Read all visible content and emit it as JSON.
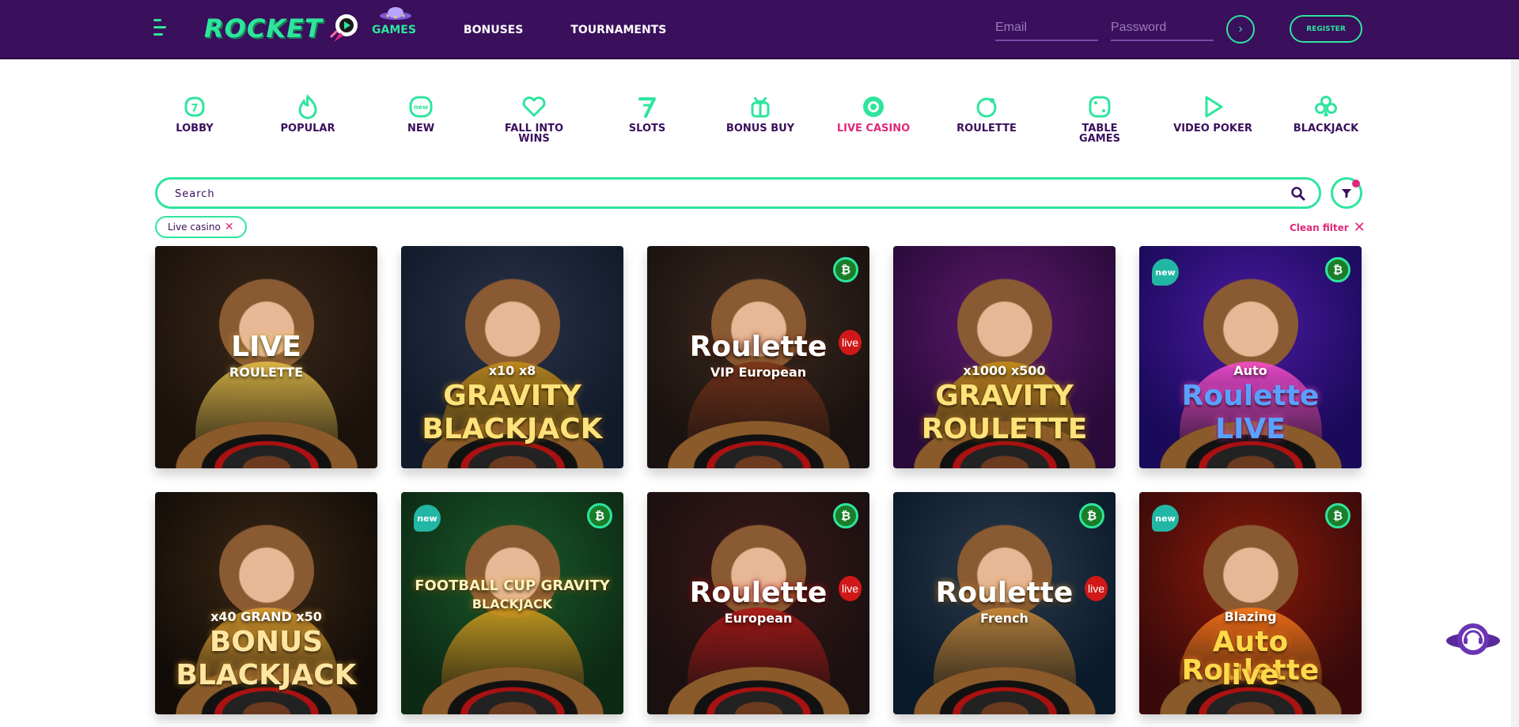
{
  "header": {
    "logo_text": "ROCKET",
    "nav": [
      {
        "label": "GAMES",
        "active": true
      },
      {
        "label": "BONUSES",
        "active": false
      },
      {
        "label": "TOURNAMENTS",
        "active": false
      }
    ],
    "email_placeholder": "Email",
    "password_placeholder": "Password",
    "login_icon": "chevron-right-icon",
    "register_label": "REGISTER"
  },
  "categories": [
    {
      "label": "LOBBY",
      "icon": "lobby-icon",
      "active": false
    },
    {
      "label": "POPULAR",
      "icon": "flame-icon",
      "active": false
    },
    {
      "label": "NEW",
      "icon": "new-icon",
      "active": false
    },
    {
      "label": "FALL INTO WINS",
      "icon": "heart-icon",
      "active": false
    },
    {
      "label": "SLOTS",
      "icon": "seven-icon",
      "active": false
    },
    {
      "label": "BONUS BUY",
      "icon": "gift-icon",
      "active": false
    },
    {
      "label": "LIVE CASINO",
      "icon": "chip-icon",
      "active": true
    },
    {
      "label": "ROULETTE",
      "icon": "roulette-icon",
      "active": false
    },
    {
      "label": "TABLE GAMES",
      "icon": "dice-icon",
      "active": false
    },
    {
      "label": "VIDEO POKER",
      "icon": "play-icon",
      "active": false
    },
    {
      "label": "BLACKJACK",
      "icon": "club-icon",
      "active": false
    }
  ],
  "search": {
    "placeholder": "Search"
  },
  "filter": {
    "chip_label": "Live casino",
    "clean_label": "Clean filter"
  },
  "games": [
    {
      "title_lines": [
        "LIVE",
        "ROULETTE"
      ],
      "new": false,
      "btc": false,
      "colors": [
        "#1b120c",
        "#3a2718"
      ],
      "title_color": "#ffffff",
      "accent": "#e8c14a"
    },
    {
      "title_lines": [
        "x10  x8",
        "GRAVITY",
        "BLACKJACK"
      ],
      "new": false,
      "btc": false,
      "colors": [
        "#111a2b",
        "#2a3346"
      ],
      "title_color": "#ffe27a",
      "accent": "#c8901a"
    },
    {
      "title_lines": [
        "Roulette",
        "VIP European"
      ],
      "new": false,
      "btc": true,
      "live": true,
      "colors": [
        "#1a1210",
        "#3a2a20"
      ],
      "title_color": "#ffffff",
      "accent": "#7a3318"
    },
    {
      "title_lines": [
        "x1000  x500",
        "GRAVITY",
        "ROULETTE"
      ],
      "new": false,
      "btc": false,
      "colors": [
        "#2a0a3a",
        "#5b1a6a"
      ],
      "title_color": "#ffe27a",
      "accent": "#c8901a"
    },
    {
      "title_lines": [
        "Auto",
        "Roulette",
        "LIVE"
      ],
      "new": true,
      "btc": true,
      "colors": [
        "#1a0a5a",
        "#4a1aa0"
      ],
      "title_color": "#5aa0ff",
      "accent": "#ff4fd1"
    },
    {
      "title_lines": [
        "x40  GRAND  x50",
        "BONUS",
        "BLACKJACK"
      ],
      "new": false,
      "btc": false,
      "colors": [
        "#120c08",
        "#3a2814"
      ],
      "title_color": "#ffe6a0",
      "accent": "#e0a030"
    },
    {
      "title_lines": [
        "FOOTBALL CUP GRAVITY",
        "BLACKJACK"
      ],
      "new": true,
      "btc": true,
      "colors": [
        "#0d2a14",
        "#1a5a2a"
      ],
      "title_color": "#fff5c0",
      "accent": "#d8a020"
    },
    {
      "title_lines": [
        "Roulette",
        "European"
      ],
      "new": false,
      "btc": true,
      "live": true,
      "colors": [
        "#1a1010",
        "#3a1818"
      ],
      "title_color": "#ffffff",
      "accent": "#b01818"
    },
    {
      "title_lines": [
        "Roulette",
        "French"
      ],
      "new": false,
      "btc": true,
      "live": true,
      "colors": [
        "#0a1a2a",
        "#2a3a4a"
      ],
      "title_color": "#ffffff",
      "accent": "#c88a3a"
    },
    {
      "title_lines": [
        "Blazing",
        "Auto Roulette",
        "live"
      ],
      "new": true,
      "btc": true,
      "colors": [
        "#3a0a0a",
        "#8a1a0a"
      ],
      "title_color": "#ffd94a",
      "accent": "#ff7a1a"
    }
  ],
  "support_icon": "support-bot-icon"
}
